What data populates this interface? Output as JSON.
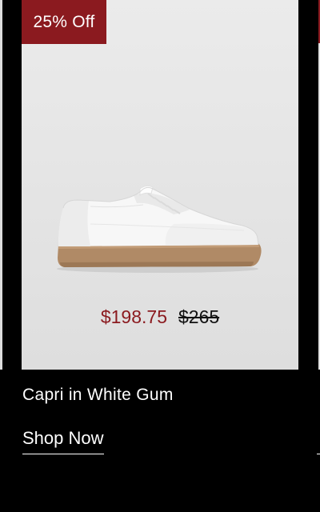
{
  "product": {
    "badge": "25% Off",
    "sale_price": "$198.75",
    "original_price": "$265",
    "name": "Capri in White Gum",
    "cta_label": "Shop Now",
    "image_icon": "white-sneaker-gum-sole"
  },
  "colors": {
    "badge_bg": "#8b1a1f",
    "sale_price": "#8b1a1f",
    "page_bg": "#000000",
    "card_bg": "#e6e6e6",
    "text_light": "#ffffff"
  }
}
